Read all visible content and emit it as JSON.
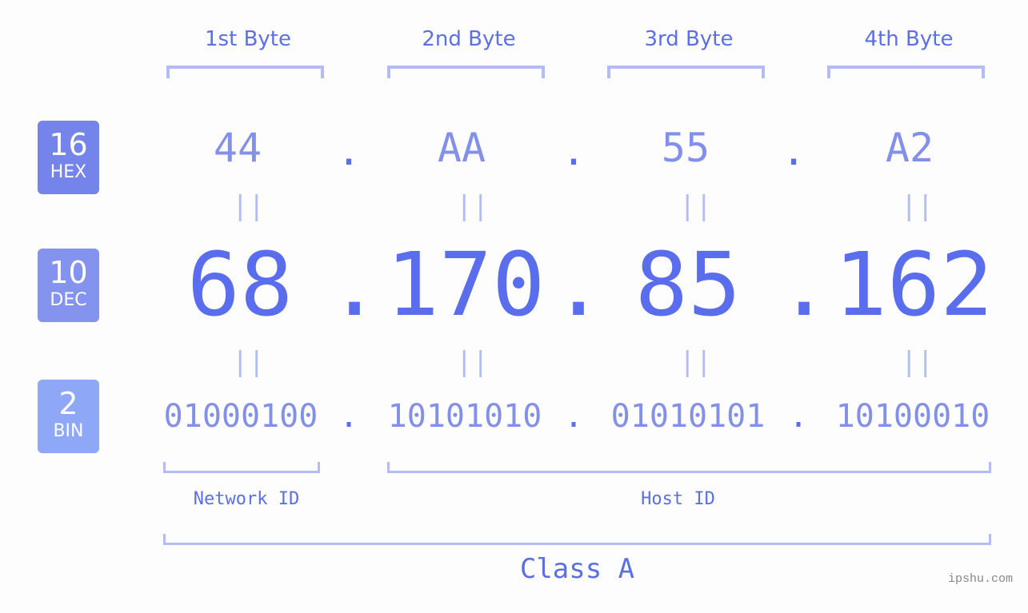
{
  "badges": [
    {
      "num": "16",
      "label": "HEX",
      "color": "#7584ea"
    },
    {
      "num": "10",
      "label": "DEC",
      "color": "#8393ee"
    },
    {
      "num": "2",
      "label": "BIN",
      "color": "#8ea8f7"
    }
  ],
  "byte_headers": [
    "1st Byte",
    "2nd Byte",
    "3rd Byte",
    "4th Byte"
  ],
  "hex": [
    "44",
    "AA",
    "55",
    "A2"
  ],
  "dec": [
    "68",
    "170",
    "85",
    "162"
  ],
  "bin": [
    "01000100",
    "10101010",
    "01010101",
    "10100010"
  ],
  "separator": ".",
  "equals": "||",
  "network_id_label": "Network ID",
  "host_id_label": "Host ID",
  "class_label": "Class A",
  "watermark": "ipshu.com"
}
